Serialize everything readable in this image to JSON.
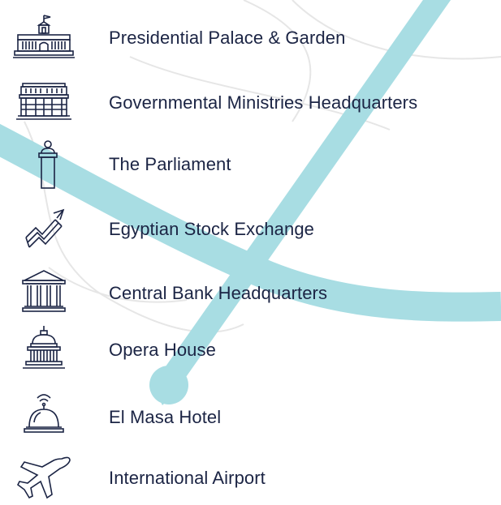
{
  "colors": {
    "route": "#a8dde3",
    "map_lines": "#e6e6e6",
    "icon_stroke": "#1b2444",
    "text": "#1b2444"
  },
  "legend": {
    "items": [
      {
        "icon": "palace-icon",
        "label": "Presidential Palace & Garden"
      },
      {
        "icon": "ministries-icon",
        "label": "Governmental Ministries Headquarters"
      },
      {
        "icon": "podium-icon",
        "label": "The Parliament"
      },
      {
        "icon": "stock-chart-icon",
        "label": "Egyptian Stock Exchange"
      },
      {
        "icon": "bank-icon",
        "label": "Central Bank Headquarters"
      },
      {
        "icon": "dome-icon",
        "label": "Opera House"
      },
      {
        "icon": "reception-bell-icon",
        "label": "El Masa Hotel"
      },
      {
        "icon": "airplane-icon",
        "label": "International Airport"
      }
    ]
  }
}
